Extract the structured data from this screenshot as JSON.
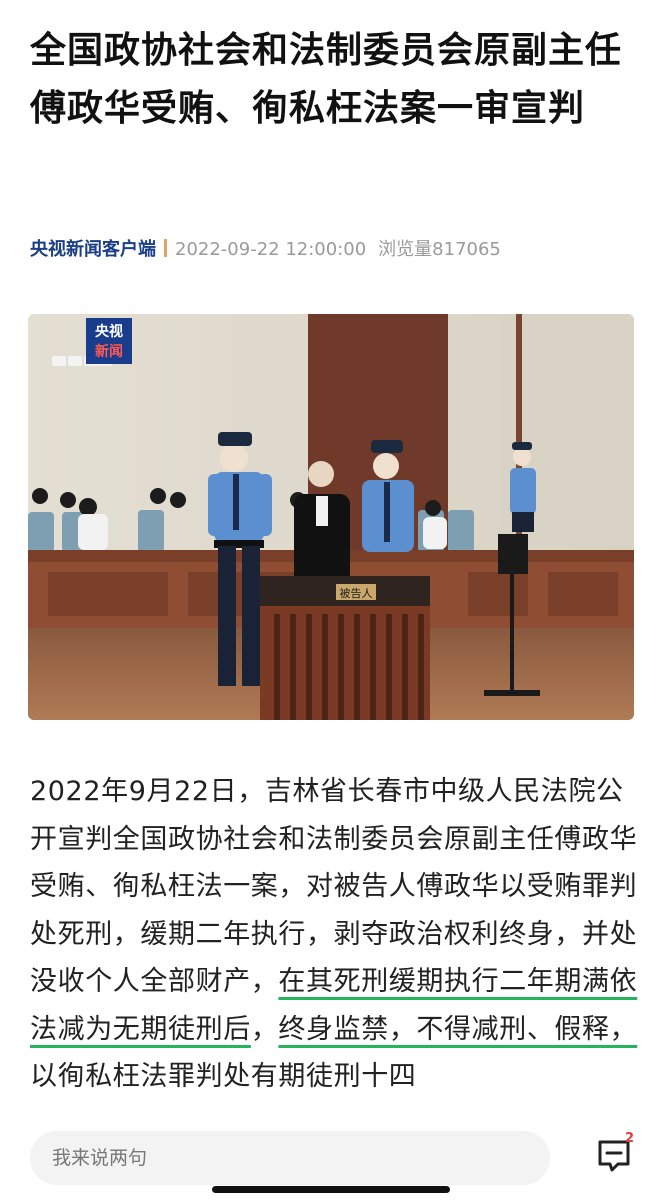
{
  "article": {
    "title": "全国政协社会和法制委员会原副主任傅政华受贿、徇私枉法案一审宣判",
    "source": "央视新闻客户端",
    "datetime": "2022-09-22 12:00:00",
    "views": "浏览量817065"
  },
  "photo": {
    "logo_line1": "央视",
    "logo_line2": "新闻",
    "placard": "被告人",
    "description": ""
  },
  "paragraph": {
    "part1": "2022年9月22日，吉林省长春市中级人民法院公开宣判全国政协社会和法制委员会原副主任傅政华受贿、徇私枉法一案，对被告人傅政华以受贿罪判处死刑，缓期二年执行，剥夺政治权利终身，并处没收个人全部财产，",
    "hl1": "在其死刑缓期执行二年期满依法减为无期徒刑后",
    "mid": "，",
    "hl2": "终身监禁，不得减刑、假释，",
    "part2": "以徇私枉法罪判处有期徒刑十四"
  },
  "comment_bar": {
    "placeholder": "我来说两句",
    "badge_count": "2"
  },
  "colors": {
    "source_link": "#1b3e88",
    "underline": "#27b35b",
    "badge": "#e0393e"
  }
}
